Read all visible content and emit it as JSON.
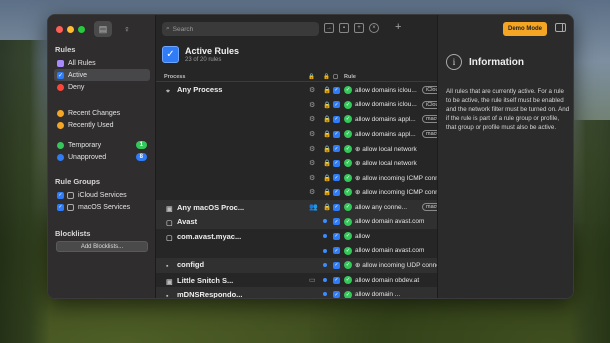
{
  "sidebar": {
    "rules_head": "Rules",
    "rules": [
      {
        "label": "All Rules",
        "color": "#a78bfa"
      },
      {
        "label": "Active",
        "color": "#2f7cf6"
      },
      {
        "label": "Deny",
        "color": "#ff453a"
      }
    ],
    "changes": [
      {
        "label": "Recent Changes",
        "color": "#f5a524"
      },
      {
        "label": "Recently Used",
        "color": "#f5a524"
      }
    ],
    "states": [
      {
        "label": "Temporary",
        "badge": "1",
        "badge_color": "#34c759",
        "color": "#34c759"
      },
      {
        "label": "Unapproved",
        "badge": "8",
        "badge_color": "#2f7cf6",
        "color": "#2f7cf6"
      }
    ],
    "groups_head": "Rule Groups",
    "groups": [
      {
        "label": "iCloud Services"
      },
      {
        "label": "macOS Services"
      }
    ],
    "blocklists_head": "Blocklists",
    "add_blocklists": "Add Blocklists..."
  },
  "toolbar": {
    "search_placeholder": "Search"
  },
  "header": {
    "title": "Active Rules",
    "subtitle": "23 of 20 rules"
  },
  "columns": {
    "process": "Process",
    "rule": "Rule"
  },
  "rows": [
    {
      "process": "Any Process",
      "proc_icon": "⌖",
      "group": false,
      "gear": "⚙",
      "lock": "🔒",
      "rule": "allow domains iclou...",
      "tag": "iCloud Services"
    },
    {
      "process": "",
      "gear": "⚙",
      "lock": "🔒",
      "rule": "allow domains iclou...",
      "tag": "iCloud Services"
    },
    {
      "process": "",
      "gear": "⚙",
      "lock": "🔒",
      "rule": "allow domains appl...",
      "tag": "macOS Services"
    },
    {
      "process": "",
      "gear": "⚙",
      "lock": "🔒",
      "rule": "allow domains appl...",
      "tag": "macOS Services"
    },
    {
      "process": "",
      "gear": "⚙",
      "lock": "🔒",
      "rule": "⊕ allow local network",
      "tag": ""
    },
    {
      "process": "",
      "gear": "⚙",
      "lock": "🔒",
      "rule": "⊕ allow local network",
      "tag": ""
    },
    {
      "process": "",
      "gear": "⚙",
      "lock": "🔒",
      "rule": "⊕ allow incoming ICMP connections (...",
      "tag": ""
    },
    {
      "process": "",
      "gear": "⚙",
      "lock": "🔒",
      "rule": "⊕ allow incoming ICMP connections (...",
      "tag": ""
    },
    {
      "process": "Any macOS Proc...",
      "proc_icon": "▣",
      "group": true,
      "gear": "👥",
      "lock": "🔒",
      "rule": "allow any conne...",
      "tag": "macOS Services"
    },
    {
      "process": "Avast",
      "proc_icon": "▢",
      "group": true,
      "dot": true,
      "rule": "allow domain avast.com",
      "tag": ""
    },
    {
      "process": "com.avast.myac...",
      "proc_icon": "▢",
      "group": false,
      "dot": true,
      "rule": "allow",
      "tag": ""
    },
    {
      "process": "",
      "dot": true,
      "rule": "allow domain avast.com",
      "tag": ""
    },
    {
      "process": "configd",
      "proc_icon": "▪",
      "group": true,
      "dot": true,
      "rule": "⊕ allow incoming UDP connections (...",
      "tag": ""
    },
    {
      "process": "Little Snitch S...",
      "proc_icon": "▣",
      "group": false,
      "gear": "▭",
      "dot": true,
      "rule": "allow domain obdev.at",
      "tag": ""
    },
    {
      "process": "mDNSRespondo...",
      "proc_icon": "▪",
      "group": true,
      "dot": true,
      "rule": "allow domain ...",
      "tag": ""
    }
  ],
  "actions": {
    "demo_mode": "Demo Mode"
  },
  "info": {
    "title": "Information",
    "text": "All rules that are currently active. For a rule to be active, the rule itself must be enabled and the network filter must be turned on. And if the rule is part of a rule group or profile, that group or profile must also be active."
  }
}
